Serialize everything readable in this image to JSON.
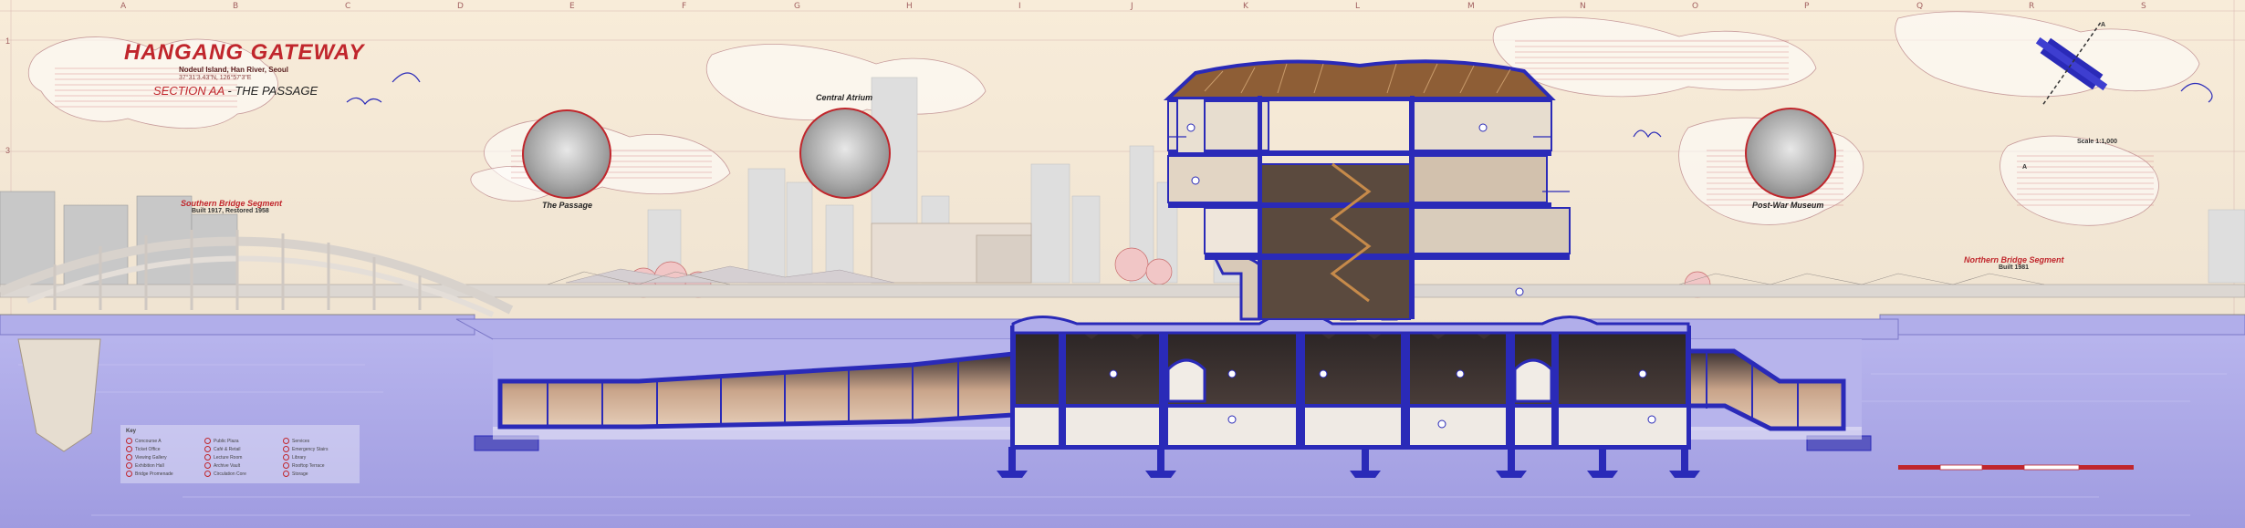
{
  "grid": {
    "letters": [
      "A",
      "B",
      "C",
      "D",
      "E",
      "F",
      "G",
      "H",
      "I",
      "J",
      "K",
      "L",
      "M",
      "N",
      "O",
      "P",
      "Q",
      "R",
      "S"
    ],
    "numbers": [
      "1",
      "3"
    ]
  },
  "title_block": {
    "title": "HANGANG GATEWAY",
    "subtitle": "Nodeul Island, Han River, Seoul",
    "coordinates": "37°31'3.43\"N, 126°57'3\"E",
    "section_prefix": "SECTION AA",
    "section_name": " - THE PASSAGE"
  },
  "insets": [
    {
      "label": "The Passage"
    },
    {
      "label": "Central Atrium"
    },
    {
      "label": "Post-War Museum"
    }
  ],
  "segments": {
    "southern_title": "Southern Bridge Segment",
    "southern_sub": "Built 1917, Restored 1958",
    "northern_title": "Northern Bridge Segment",
    "northern_sub": "Built 1981"
  },
  "scale_text": "Scale 1:1,000",
  "key_plan_markers": [
    "A",
    "A"
  ],
  "legend": {
    "title": "Key",
    "items": [
      "Concourse A",
      "Ticket Office",
      "Viewing Gallery",
      "Exhibition Hall",
      "Bridge Promenade",
      "Public Plaza",
      "Café & Retail",
      "Lecture Room",
      "Archive Vault",
      "Circulation Core",
      "Services",
      "Emergency Stairs",
      "Library",
      "Rooftop Terrace",
      "Storage"
    ]
  },
  "colors": {
    "accent_red": "#c0262c",
    "structure_blue": "#2a2ab8",
    "river_lavender": "#a9a7e6",
    "paper": "#f6ead8"
  }
}
